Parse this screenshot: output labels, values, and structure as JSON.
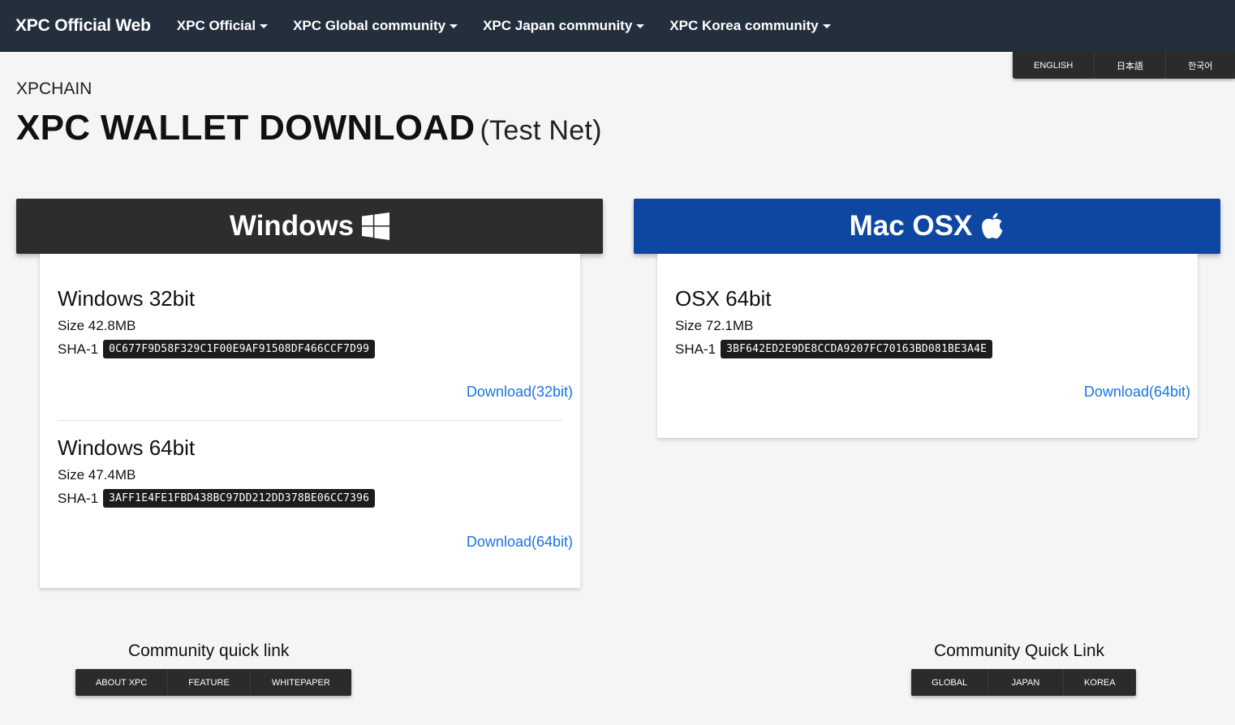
{
  "navbar": {
    "brand": "XPC Official Web",
    "items": [
      {
        "label": "XPC Official"
      },
      {
        "label": "XPC Global community"
      },
      {
        "label": "XPC Japan community"
      },
      {
        "label": "XPC Korea community"
      }
    ]
  },
  "languages": [
    "ENGLISH",
    "日本語",
    "한국어"
  ],
  "header": {
    "eyebrow": "XPCHAIN",
    "title": "XPC WALLET DOWNLOAD",
    "subtitle": "(Test Net)"
  },
  "windows": {
    "label": "Windows",
    "icon": "windows-icon",
    "builds": [
      {
        "name": "Windows 32bit",
        "size": "Size 42.8MB",
        "sha_label": "SHA-1",
        "sha": "0C677F9D58F329C1F00E9AF91508DF466CCF7D99",
        "download": "Download(32bit)"
      },
      {
        "name": "Windows 64bit",
        "size": "Size 47.4MB",
        "sha_label": "SHA-1",
        "sha": "3AFF1E4FE1FBD438BC97DD212DD378BE06CC7396",
        "download": "Download(64bit)"
      }
    ]
  },
  "mac": {
    "label": "Mac OSX",
    "icon": "apple-icon",
    "builds": [
      {
        "name": "OSX 64bit",
        "size": "Size 72.1MB",
        "sha_label": "SHA-1",
        "sha": "3BF642ED2E9DE8CCDA9207FC70163BD081BE3A4E",
        "download": "Download(64bit)"
      }
    ]
  },
  "quick_links_left": {
    "title": "Community quick link",
    "buttons": [
      "ABOUT XPC",
      "FEATURE",
      "WHITEPAPER"
    ]
  },
  "quick_links_right": {
    "title": "Community Quick Link",
    "buttons": [
      "GLOBAL",
      "JAPAN",
      "KOREA"
    ]
  },
  "colors": {
    "navbar": "#242f3e",
    "windows_header": "#2d2d2d",
    "mac_header": "#0d47a1",
    "link": "#1a73e8"
  }
}
